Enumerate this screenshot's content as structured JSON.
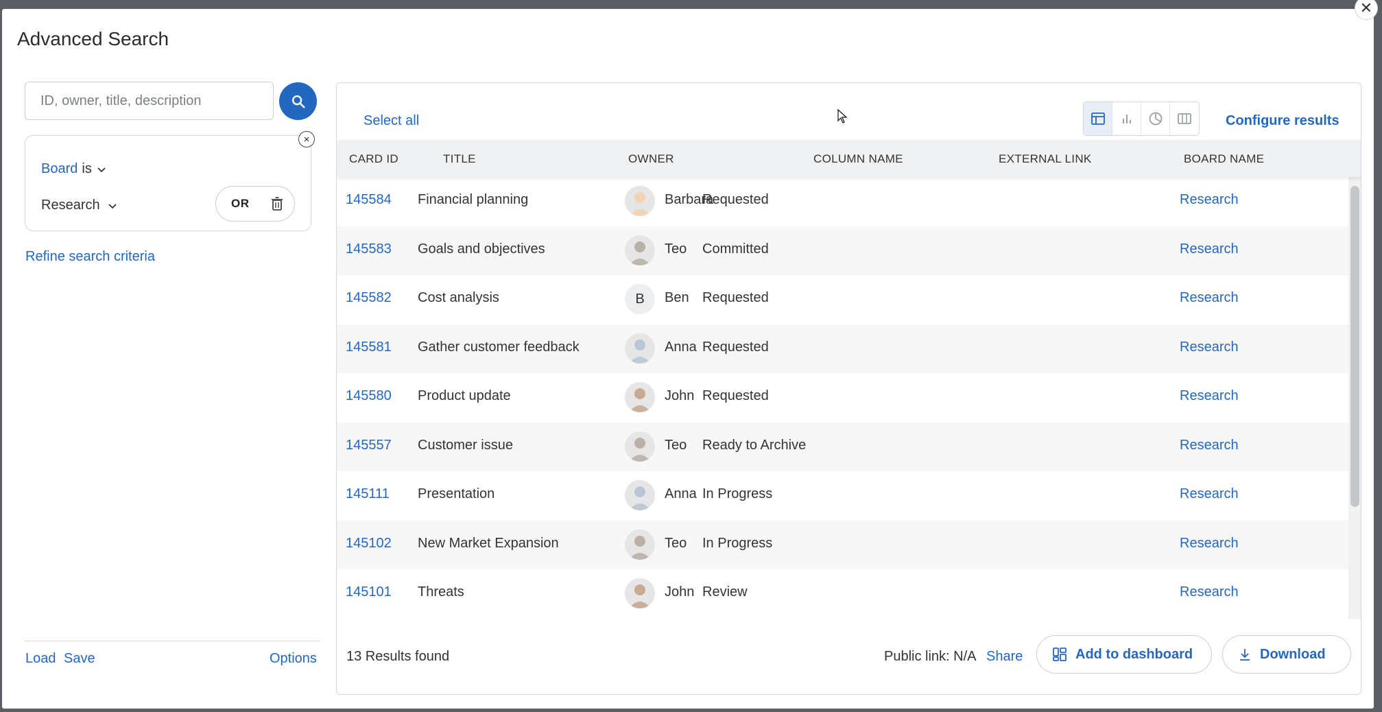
{
  "modal": {
    "title": "Advanced Search",
    "close_glyph": "✕"
  },
  "search": {
    "placeholder": "ID, owner, title, description",
    "value": ""
  },
  "criteria": {
    "field": "Board",
    "operator": "is",
    "value": "Research",
    "logic": "OR",
    "close_glyph": "×"
  },
  "refine_label": "Refine search criteria",
  "left_footer": {
    "load": "Load",
    "save": "Save",
    "options": "Options"
  },
  "toolbar": {
    "select_all": "Select all",
    "configure": "Configure results",
    "views": [
      "table-view-icon",
      "bar-chart-icon",
      "pie-chart-icon",
      "columns-view-icon"
    ]
  },
  "table": {
    "headers": [
      "CARD ID",
      "TITLE",
      "OWNER",
      "COLUMN NAME",
      "EXTERNAL LINK",
      "BOARD NAME"
    ],
    "rows": [
      {
        "id": "145584",
        "title": "Financial planning",
        "owner": "Barbara",
        "column": "Requested",
        "external": "",
        "board": "Research"
      },
      {
        "id": "145583",
        "title": "Goals and objectives",
        "owner": "Teo",
        "column": "Committed",
        "external": "",
        "board": "Research"
      },
      {
        "id": "145582",
        "title": "Cost analysis",
        "owner": "Ben",
        "column": "Requested",
        "external": "",
        "board": "Research"
      },
      {
        "id": "145581",
        "title": "Gather customer feedback",
        "owner": "Anna",
        "column": "Requested",
        "external": "",
        "board": "Research"
      },
      {
        "id": "145580",
        "title": "Product update",
        "owner": "John",
        "column": "Requested",
        "external": "",
        "board": "Research"
      },
      {
        "id": "145557",
        "title": "Customer issue",
        "owner": "Teo",
        "column": "Ready to Archive",
        "external": "",
        "board": "Research"
      },
      {
        "id": "145111",
        "title": "Presentation",
        "owner": "Anna",
        "column": "In Progress",
        "external": "",
        "board": "Research"
      },
      {
        "id": "145102",
        "title": "New Market Expansion",
        "owner": "Teo",
        "column": "In Progress",
        "external": "",
        "board": "Research"
      },
      {
        "id": "145101",
        "title": "Threats",
        "owner": "John",
        "column": "Review",
        "external": "",
        "board": "Research"
      }
    ]
  },
  "avatar_initials": {
    "Ben": "B"
  },
  "footer": {
    "results_count": "13 Results found",
    "public_link": "Public link: N/A",
    "share": "Share",
    "add_dashboard": "Add to dashboard",
    "download": "Download"
  },
  "colors": {
    "accent": "#2467bf",
    "header_bg": "#eff1f3",
    "row_alt": "#f7f7f8"
  }
}
